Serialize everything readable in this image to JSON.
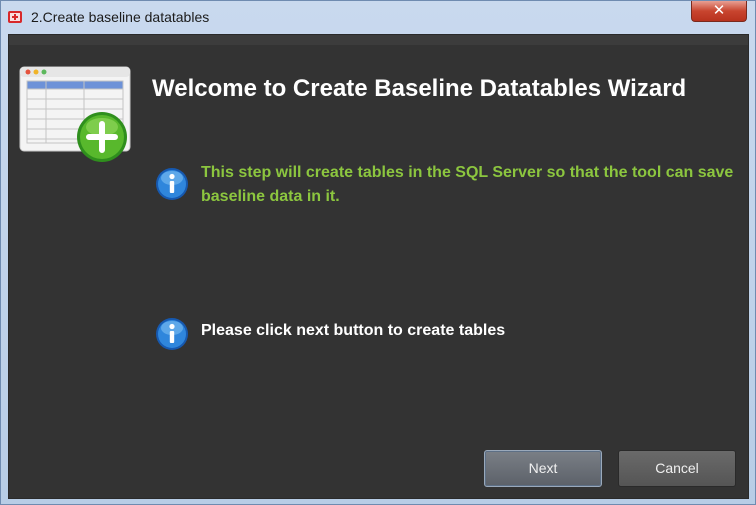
{
  "window": {
    "title": "2.Create baseline datatables",
    "close_glyph": "✕"
  },
  "wizard": {
    "heading": "Welcome to Create Baseline Datatables Wizard",
    "icon": "table-add-icon",
    "message_1": "This step will create tables in the SQL Server so that the tool can save baseline data in it.",
    "message_2": "Please click next button to create tables"
  },
  "buttons": {
    "next_label": "Next",
    "cancel_label": "Cancel"
  },
  "colors": {
    "background": "#333333",
    "accent_green": "#8cc63f",
    "info_blue": "#1b73c8"
  }
}
